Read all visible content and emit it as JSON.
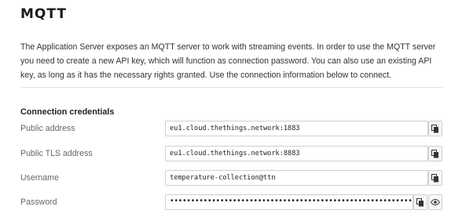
{
  "header": {
    "title": "MQTT"
  },
  "description": "The Application Server exposes an MQTT server to work with streaming events. In order to use the MQTT server you need to create a new API key, which will function as connection password. You can also use an existing API key, as long as it has the necessary rights granted. Use the connection information below to connect.",
  "credentials": {
    "section_title": "Connection credentials",
    "fields": [
      {
        "label": "Public address",
        "value": "eu1.cloud.thethings.network:1883",
        "icons": [
          "copy-icon"
        ]
      },
      {
        "label": "Public TLS address",
        "value": "eu1.cloud.thethings.network:8883",
        "icons": [
          "copy-icon"
        ]
      },
      {
        "label": "Username",
        "value": "temperature-collection@ttn",
        "icons": [
          "copy-icon"
        ]
      },
      {
        "label": "Password",
        "value": "••••••••••••••••••••••••••••••••••••••••••••••••••••••••••••••••••••••••",
        "icons": [
          "copy-icon",
          "eye-icon"
        ]
      }
    ]
  }
}
